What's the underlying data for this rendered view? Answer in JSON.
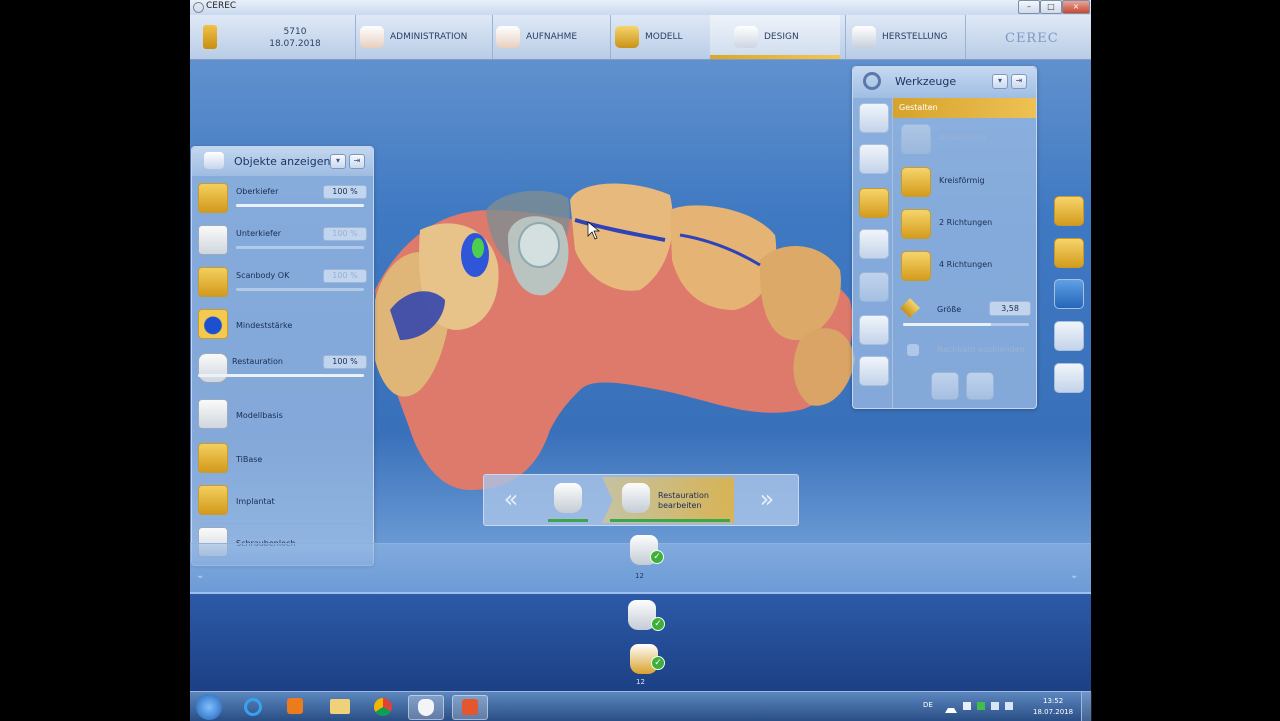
{
  "window": {
    "title": "CEREC",
    "controls": [
      "–",
      "□",
      "×"
    ]
  },
  "case": {
    "id": "5710",
    "date": "18.07.2018"
  },
  "nav": {
    "steps": [
      {
        "label": "ADMINISTRATION"
      },
      {
        "label": "AUFNAHME"
      },
      {
        "label": "MODELL"
      },
      {
        "label": "DESIGN"
      },
      {
        "label": "HERSTELLUNG"
      }
    ],
    "active": "DESIGN",
    "logo": "CEREC"
  },
  "objects_panel": {
    "title": "Objekte anzeigen",
    "items": [
      {
        "label": "Oberkiefer",
        "value": "100 %",
        "level": 1.0,
        "active": true
      },
      {
        "label": "Unterkiefer",
        "value": "100 %",
        "level": 1.0,
        "active": false
      },
      {
        "label": "Scanbody OK",
        "value": "100 %",
        "level": 1.0,
        "active": false
      },
      {
        "label": "Mindeststärke",
        "value": "",
        "level": null,
        "active": true
      },
      {
        "label": "Restauration",
        "value": "100 %",
        "level": 1.0,
        "active": true
      },
      {
        "label": "Modellbasis",
        "value": "",
        "level": null,
        "active": true
      },
      {
        "label": "TiBase",
        "value": "",
        "level": null,
        "active": true
      },
      {
        "label": "Implantat",
        "value": "",
        "level": null,
        "active": true
      },
      {
        "label": "Schraubenloch",
        "value": "",
        "level": null,
        "active": true
      }
    ]
  },
  "tools_panel": {
    "title": "Werkzeuge",
    "section": "Gestalten",
    "options": [
      {
        "label": "Anatomisch",
        "enabled": false
      },
      {
        "label": "Kreisförmig",
        "enabled": true
      },
      {
        "label": "2 Richtungen",
        "enabled": true
      },
      {
        "label": "4 Richtungen",
        "enabled": true
      }
    ],
    "size_label": "Größe",
    "size_value": "3,58",
    "size_level": 0.7,
    "hide_neighbors_label": "Nachbarn ausblenden"
  },
  "workflow": {
    "current_label_line1": "Restauration",
    "current_label_line2": "bearbeiten"
  },
  "thumbnails": {
    "tooth_number": "12"
  },
  "taskbar": {
    "lang": "DE",
    "time": "13:52",
    "date": "18.07.2018"
  },
  "colors": {
    "accent": "#e6b232",
    "panel": "#a0bee4",
    "gum": "#e0756a"
  }
}
